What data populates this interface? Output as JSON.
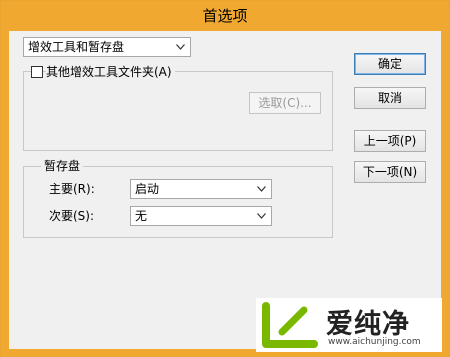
{
  "window": {
    "title": "首选项"
  },
  "section_select": {
    "value": "增效工具和暂存盘"
  },
  "plugins": {
    "checkbox_label": "其他增效工具文件夹(A)",
    "checked": false,
    "choose_button": "选取(C)..."
  },
  "scratch": {
    "legend": "暂存盘",
    "primary_label": "主要(R):",
    "primary_value": "启动",
    "secondary_label": "次要(S):",
    "secondary_value": "无"
  },
  "buttons": {
    "ok": "确定",
    "cancel": "取消",
    "prev": "上一项(P)",
    "next": "下一项(N)"
  },
  "watermark": {
    "text": "爱纯净",
    "url": "www.aichunjing.com"
  }
}
